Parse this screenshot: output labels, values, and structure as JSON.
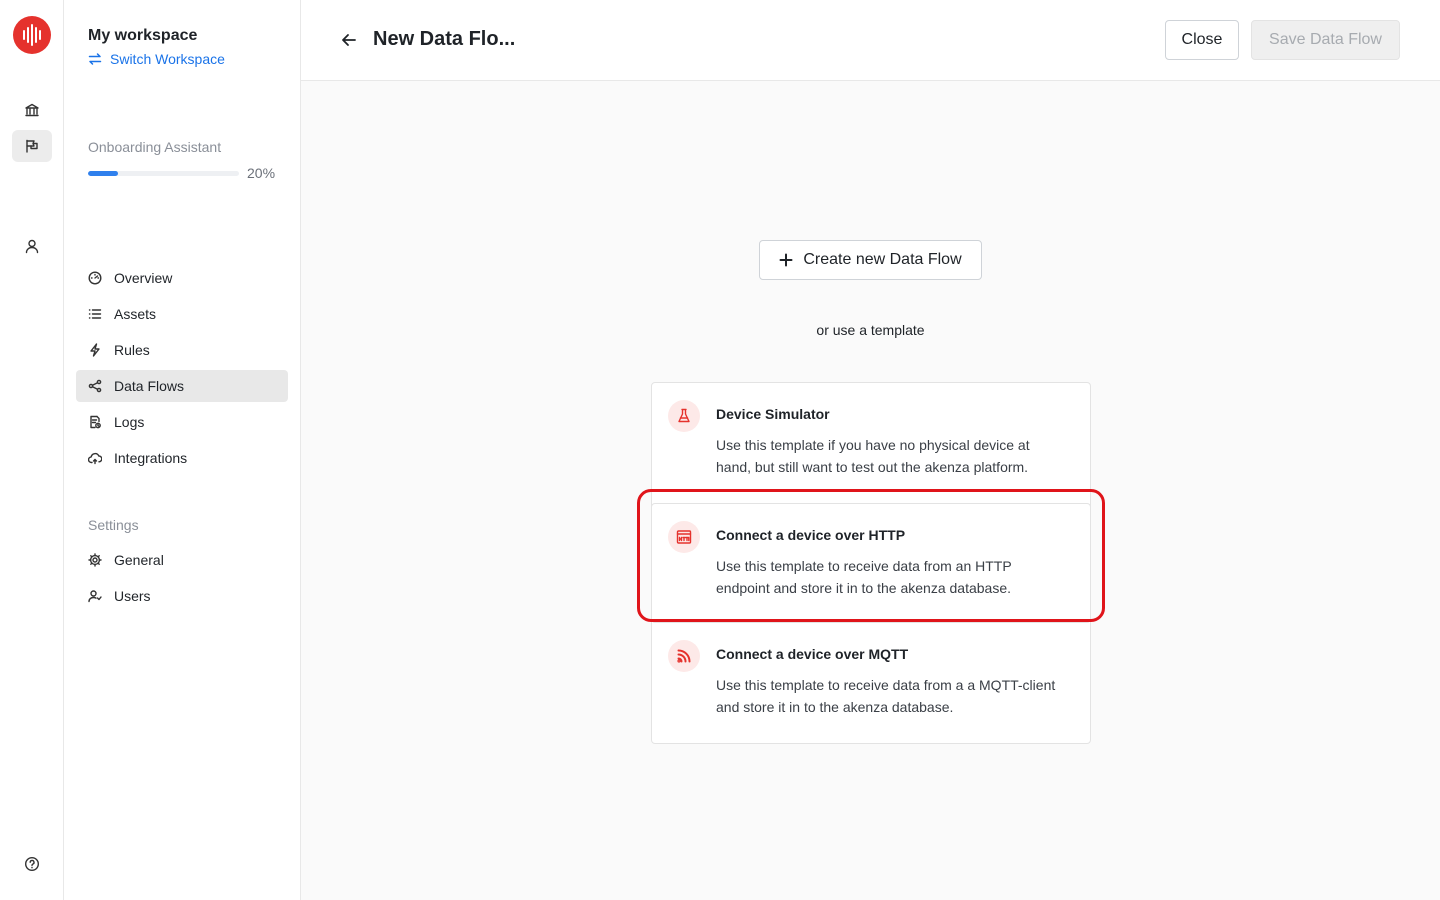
{
  "workspace": {
    "name": "My workspace",
    "switch_label": "Switch Workspace"
  },
  "onboarding": {
    "label": "Onboarding Assistant",
    "progress_text": "20%",
    "progress_fraction": 0.2
  },
  "nav": {
    "items": [
      {
        "label": "Overview",
        "icon": "dashboard-icon"
      },
      {
        "label": "Assets",
        "icon": "list-icon"
      },
      {
        "label": "Rules",
        "icon": "lightning-icon"
      },
      {
        "label": "Data Flows",
        "icon": "share-icon",
        "active": true
      },
      {
        "label": "Logs",
        "icon": "log-file-icon"
      },
      {
        "label": "Integrations",
        "icon": "cloud-icon"
      }
    ],
    "settings_label": "Settings",
    "settings_items": [
      {
        "label": "General",
        "icon": "gear-icon"
      },
      {
        "label": "Users",
        "icon": "users-icon"
      }
    ]
  },
  "header": {
    "title": "New Data Flo...",
    "close_label": "Close",
    "save_label": "Save Data Flow"
  },
  "main": {
    "create_label": "Create new Data Flow",
    "or_text": "or use a template",
    "templates": [
      {
        "title": "Device Simulator",
        "description": "Use this template if you have no physical device at hand, but still want to test out the akenza platform.",
        "icon": "flask-icon"
      },
      {
        "title": "Connect a device over HTTP",
        "description": "Use this template to receive data from an HTTP endpoint and store it in to the akenza database.",
        "icon": "http-icon"
      },
      {
        "title": "Connect a device over MQTT",
        "description": "Use this template to receive data from a a MQTT-client and store it in to the akenza database.",
        "icon": "rss-icon"
      }
    ]
  },
  "colors": {
    "brand": "#e5322d",
    "link": "#1a73e8",
    "progress": "#2f80ed",
    "highlight": "#e0141a"
  }
}
